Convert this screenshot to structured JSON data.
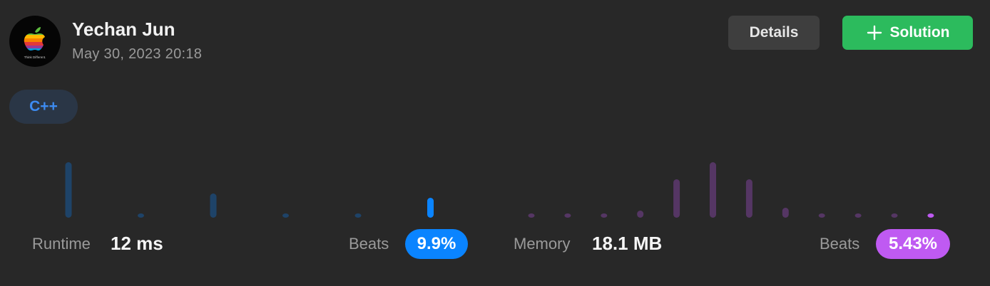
{
  "header": {
    "user_name": "Yechan Jun",
    "timestamp": "May 30, 2023 20:18",
    "avatar_icon": "apple-rainbow-logo-icon",
    "avatar_caption": "Think Different."
  },
  "actions": {
    "details_label": "Details",
    "solution_label": "Solution",
    "solution_icon": "plus-icon",
    "solution_color": "#2cbb5d"
  },
  "language_tag": "C++",
  "distribution": {
    "runtime_color": "#0a84ff",
    "memory_color": "#bf5af2",
    "runtime_bars": [
      {
        "height": 78,
        "selected": false
      },
      {
        "height": 6,
        "selected": false
      },
      {
        "height": 34,
        "selected": false
      },
      {
        "height": 6,
        "selected": false
      },
      {
        "height": 6,
        "selected": false
      },
      {
        "height": 28,
        "selected": true
      }
    ],
    "memory_bars": [
      {
        "height": 6,
        "selected": false
      },
      {
        "height": 6,
        "selected": false
      },
      {
        "height": 6,
        "selected": false
      },
      {
        "height": 10,
        "selected": false
      },
      {
        "height": 54,
        "selected": false
      },
      {
        "height": 78,
        "selected": false
      },
      {
        "height": 54,
        "selected": false
      },
      {
        "height": 14,
        "selected": false
      },
      {
        "height": 6,
        "selected": false
      },
      {
        "height": 6,
        "selected": false
      },
      {
        "height": 6,
        "selected": false
      },
      {
        "height": 6,
        "selected": true
      }
    ]
  },
  "stats": {
    "runtime_label": "Runtime",
    "runtime_value": "12 ms",
    "runtime_beats_label": "Beats",
    "runtime_beats": "9.9%",
    "memory_label": "Memory",
    "memory_value": "18.1 MB",
    "memory_beats_label": "Beats",
    "memory_beats": "5.43%"
  }
}
